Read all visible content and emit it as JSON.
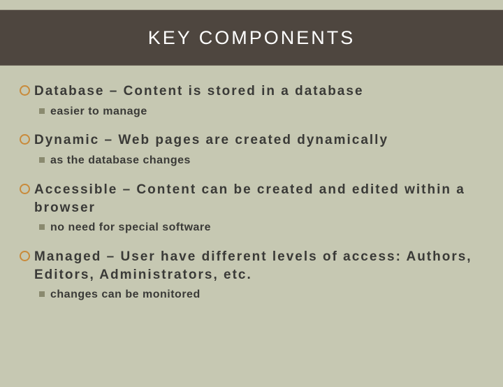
{
  "title": "KEY COMPONENTS",
  "items": [
    {
      "main": "Database – Content is stored in a database",
      "sub": "easier to manage"
    },
    {
      "main": "Dynamic – Web pages are created dynamically",
      "sub": "as the database changes"
    },
    {
      "main": "Accessible – Content can be created and edited within a browser",
      "sub": "no need for special software"
    },
    {
      "main": "Managed – User have different levels of access: Authors, Editors, Administrators, etc.",
      "sub": "changes can be monitored"
    }
  ]
}
